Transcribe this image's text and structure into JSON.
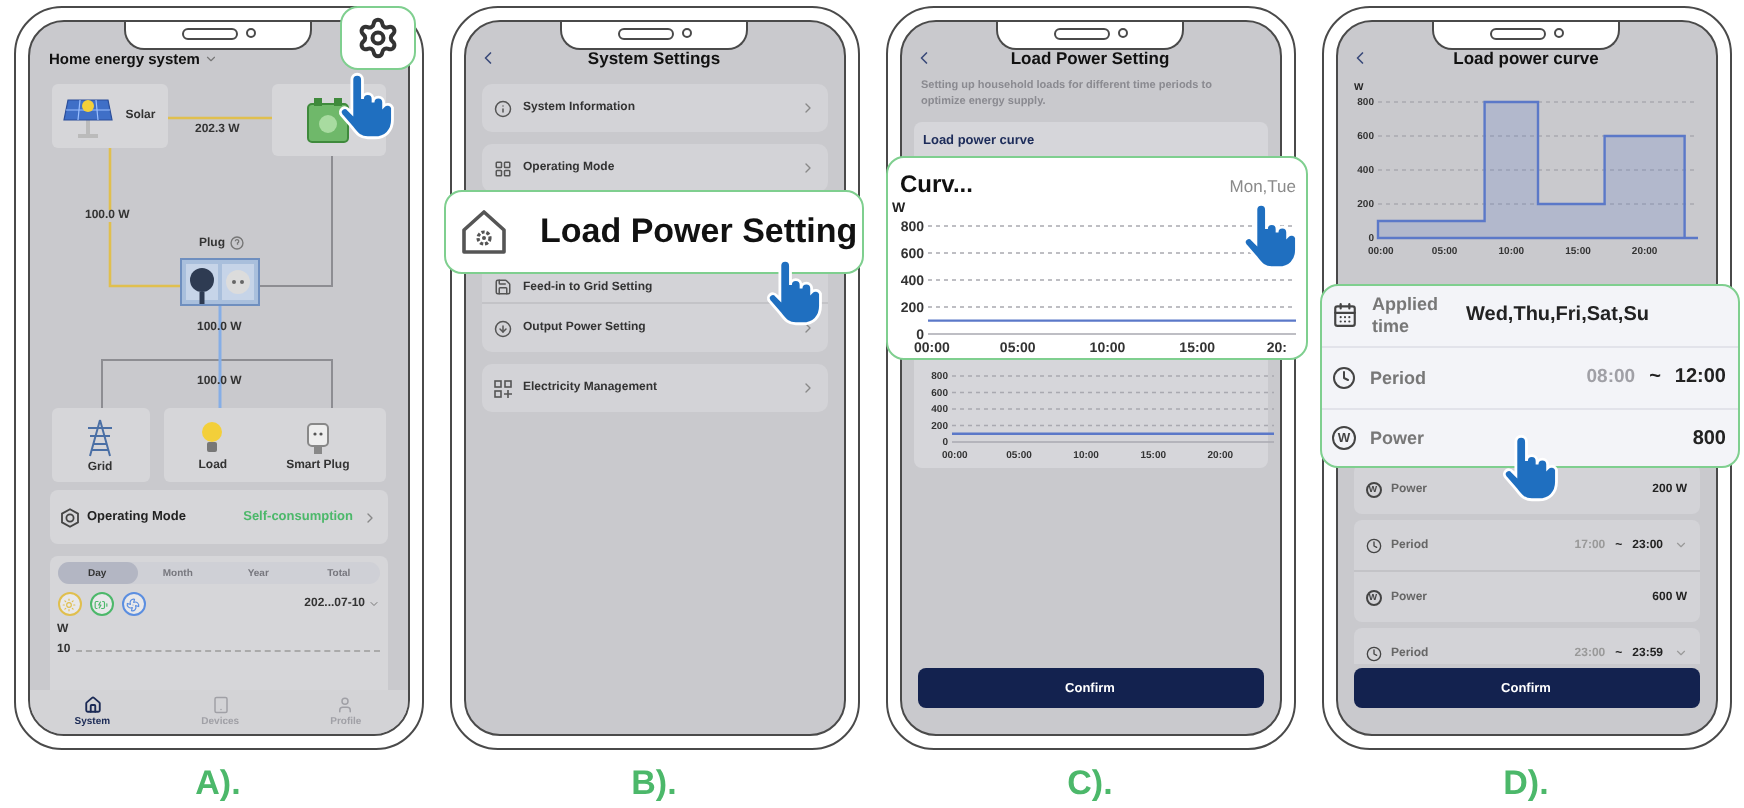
{
  "panel_a": {
    "caption": "A).",
    "title": "Home energy system",
    "flow": {
      "solar": "Solar",
      "solar_to_battery": "202.3 W",
      "solar_to_plug": "100.0 W",
      "plug": "Plug",
      "plug_out": "100.0 W",
      "to_load": "100.0 W"
    },
    "devices": [
      {
        "kind": "grid",
        "label": "Grid"
      },
      {
        "kind": "load",
        "label": "Load"
      },
      {
        "kind": "smart_plug",
        "label": "Smart Plug"
      }
    ],
    "operating_mode": {
      "label": "Operating Mode",
      "value": "Self-consumption"
    },
    "periods": [
      {
        "label": "Day",
        "selected": true
      },
      {
        "label": "Month",
        "selected": false
      },
      {
        "label": "Year",
        "selected": false
      },
      {
        "label": "Total",
        "selected": false
      }
    ],
    "date": "202...07-10",
    "unit": "W",
    "tick": "10",
    "nav": [
      {
        "kind": "system",
        "label": "System",
        "selected": true
      },
      {
        "kind": "devices",
        "label": "Devices",
        "selected": false
      },
      {
        "kind": "profile",
        "label": "Profile",
        "selected": false
      }
    ]
  },
  "panel_b": {
    "caption": "B).",
    "title": "System Settings",
    "groups": [
      [
        {
          "kind": "info",
          "label": "System Information"
        }
      ],
      [
        {
          "kind": "grid",
          "label": "Operating Mode"
        }
      ],
      [
        {
          "kind": "covered"
        },
        {
          "kind": "feed",
          "label": "Feed-in to Grid Setting"
        },
        {
          "kind": "output",
          "label": "Output Power Setting"
        }
      ],
      [
        {
          "kind": "grid_plus",
          "label": "Electricity Management"
        }
      ]
    ],
    "callout": "Load Power Setting"
  },
  "panel_c": {
    "caption": "C).",
    "title": "Load Power Setting",
    "description": "Setting up household loads for different time periods to optimize energy supply.",
    "card_title": "Load power curve",
    "chart_data": {
      "type": "line",
      "grid": true,
      "x": [
        0,
        24
      ],
      "series": [
        {
          "color": "#5b78c8",
          "values": [
            100,
            100
          ]
        }
      ],
      "xlim": [
        0,
        24
      ],
      "ylim": [
        0,
        800
      ],
      "yticks": [
        0,
        200,
        400,
        600,
        800
      ],
      "xticks": [
        {
          "value": 0,
          "label": "00:00"
        },
        {
          "value": 5,
          "label": "05:00"
        },
        {
          "value": 10,
          "label": "10:00"
        },
        {
          "value": 15,
          "label": "15:00"
        },
        {
          "value": 20,
          "label": "20:00"
        }
      ]
    },
    "confirm": "Confirm",
    "callout": {
      "title": "Curv...",
      "days": "Mon,Tue",
      "chart_data": {
        "type": "line",
        "grid": true,
        "ylabel": "W",
        "x": [
          0,
          20.5
        ],
        "series": [
          {
            "color": "#5b78c8",
            "values": [
              100,
              100
            ]
          }
        ],
        "xlim": [
          0,
          20.5
        ],
        "ylim": [
          0,
          800
        ],
        "yticks": [
          0,
          200,
          400,
          600,
          800
        ],
        "xticks": [
          {
            "value": 0,
            "label": "00:00"
          },
          {
            "value": 5,
            "label": "05:00"
          },
          {
            "value": 10,
            "label": "10:00"
          },
          {
            "value": 15,
            "label": "15:00"
          },
          {
            "value": 20,
            "label": "20:"
          }
        ]
      }
    }
  },
  "panel_d": {
    "caption": "D).",
    "title": "Load power curve",
    "chart_data": {
      "type": "area",
      "grid": true,
      "ylabel": "W",
      "x": [
        0,
        8,
        8,
        12,
        12,
        17,
        17,
        23,
        23,
        24
      ],
      "series": [
        {
          "color": "#5b78c8",
          "values": [
            100,
            100,
            800,
            800,
            200,
            200,
            600,
            600,
            0,
            0
          ]
        }
      ],
      "xlim": [
        0,
        24
      ],
      "ylim": [
        0,
        800
      ],
      "yticks": [
        0,
        200,
        400,
        600,
        800
      ],
      "xticks": [
        {
          "value": 0,
          "label": "00:00"
        },
        {
          "value": 5,
          "label": "05:00"
        },
        {
          "value": 10,
          "label": "10:00"
        },
        {
          "value": 15,
          "label": "15:00"
        },
        {
          "value": 20,
          "label": "20:00"
        }
      ]
    },
    "callout": {
      "applied_label": "Applied time",
      "applied_value": "Wed,Thu,Fri,Sat,Su",
      "period_label": "Period",
      "start": "08:00",
      "separator": "~",
      "end": "12:00",
      "power_icon": "W",
      "power_label": "Power",
      "power": "800"
    },
    "cards": [
      [
        {
          "kind": "power",
          "icon": "W",
          "label": "Power",
          "value": "200 W"
        }
      ],
      [
        {
          "kind": "period",
          "label": "Period",
          "start": "17:00",
          "separator": "~",
          "end": "23:00"
        },
        {
          "kind": "power",
          "icon": "W",
          "label": "Power",
          "value": "600 W"
        }
      ],
      [
        {
          "kind": "period",
          "label": "Period",
          "start": "23:00",
          "separator": "~",
          "end": "23:59"
        }
      ]
    ],
    "confirm": "Confirm"
  }
}
